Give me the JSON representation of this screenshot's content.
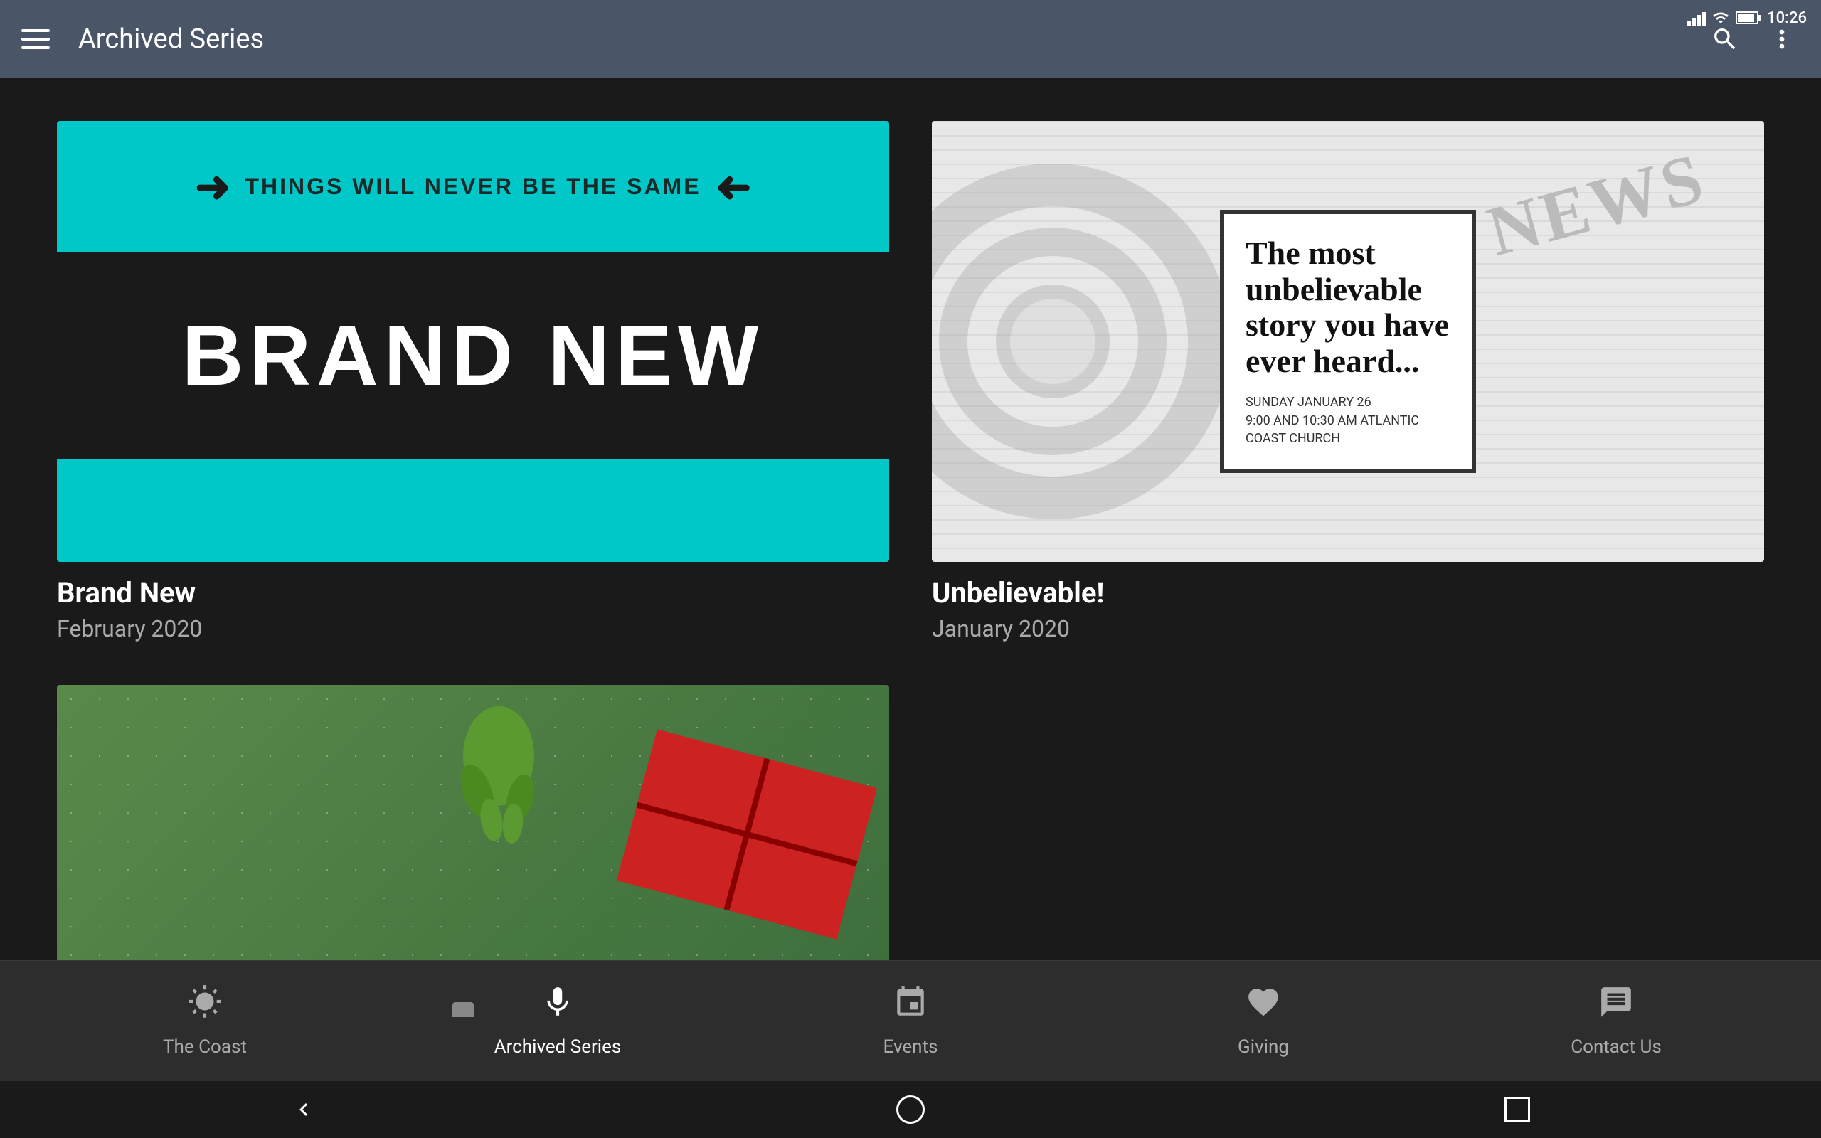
{
  "statusBar": {
    "time": "10:26"
  },
  "appBar": {
    "title": "Archived Series",
    "menuIcon": "menu-icon",
    "searchIcon": "search-icon",
    "moreIcon": "more-vertical-icon"
  },
  "cards": [
    {
      "id": "brand-new",
      "tagline": "THINGS WILL NEVER BE THE SAME",
      "mainText": "BRAND NEW",
      "title": "Brand New",
      "date": "February 2020"
    },
    {
      "id": "unbelievable",
      "storyText": "The most unbelievable story you have ever heard...",
      "storySub": "SUNDAY JANUARY 26\n9:00 AND 10:30 AM     ATLANTIC COAST CHURCH",
      "newsWord": "NEWS",
      "title": "Unbelievable!",
      "date": "January 2020"
    }
  ],
  "bottomNav": {
    "items": [
      {
        "id": "the-coast",
        "label": "The Coast",
        "icon": "sun-icon",
        "active": false
      },
      {
        "id": "archived-series",
        "label": "Archived Series",
        "icon": "mic-icon",
        "active": true
      },
      {
        "id": "events",
        "label": "Events",
        "icon": "calendar-icon",
        "active": false
      },
      {
        "id": "giving",
        "label": "Giving",
        "icon": "heart-icon",
        "active": false
      },
      {
        "id": "contact-us",
        "label": "Contact Us",
        "icon": "chat-icon",
        "active": false
      }
    ]
  }
}
